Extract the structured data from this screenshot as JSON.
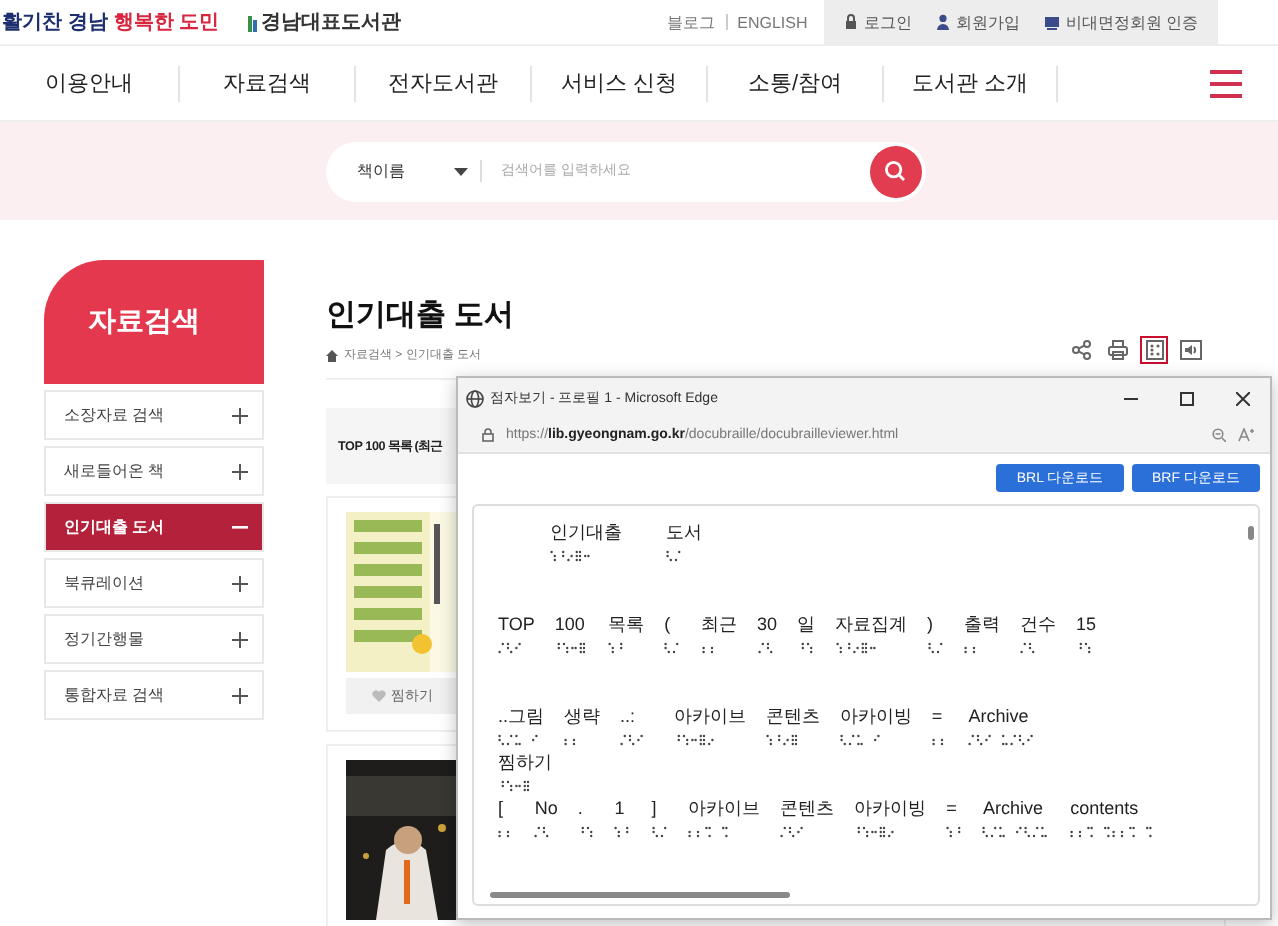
{
  "top_bar": {
    "slogan_start": "활기찬 경남",
    "slogan_end": "행복한 도민",
    "logo": "경남대표도서관",
    "links": [
      "블로그",
      "ENGLISH"
    ],
    "account": [
      {
        "kind": "lock",
        "label": "로그인"
      },
      {
        "kind": "person",
        "label": "회원가입"
      },
      {
        "kind": "card",
        "label": "비대면정회원 인증"
      }
    ]
  },
  "nav": [
    "이용안내",
    "자료검색",
    "전자도서관",
    "서비스 신청",
    "소통/참여",
    "도서관 소개"
  ],
  "search": {
    "category": "책이름",
    "placeholder": "검색어를 입력하세요"
  },
  "sidebar": {
    "title": "자료검색",
    "items": [
      {
        "label": "소장자료 검색",
        "selected": false
      },
      {
        "label": "새로들어온 책",
        "selected": false
      },
      {
        "label": "인기대출 도서",
        "selected": true
      },
      {
        "label": "북큐레이션",
        "selected": false
      },
      {
        "label": "정기간행물",
        "selected": false
      },
      {
        "label": "통합자료 검색",
        "selected": false
      }
    ]
  },
  "page": {
    "title": "인기대출 도서",
    "breadcrumb": "자료검색 > 인기대출 도서",
    "tools": [
      {
        "kind": "share",
        "selected": false
      },
      {
        "kind": "print",
        "selected": false
      },
      {
        "kind": "braille",
        "selected": true
      },
      {
        "kind": "speaker",
        "selected": false
      }
    ],
    "list_header": "TOP 100 목록 (최근",
    "books": [
      {
        "kind": "picture",
        "wish_label": "찜하기"
      },
      {
        "kind": "picture"
      }
    ]
  },
  "braille_window": {
    "title": "점자보기 - 프로필 1 - Microsoft Edge",
    "url": "https://**lib.gyeongnam.go.kr**/docubraille/docubrailleviewer.html",
    "buttons": [
      "BRL 다운로드",
      "BRF 다운로드"
    ],
    "lines": [
      [
        "인기대출",
        "도서"
      ],
      [
        "TOP",
        "100",
        "목록",
        "(",
        "최근",
        "30",
        "일",
        "자료집계",
        ")",
        "출력",
        "건수",
        "15"
      ],
      [
        "..그림",
        "생략",
        "..:",
        "아카이브",
        "콘텐츠",
        "아카이빙",
        "=",
        "Archive"
      ],
      [
        "찜하기"
      ],
      [
        "[",
        "No",
        ".",
        "1",
        "]",
        "아카이브",
        "콘텐츠",
        "아카이빙",
        "=",
        "Archive",
        "contents"
      ]
    ]
  }
}
